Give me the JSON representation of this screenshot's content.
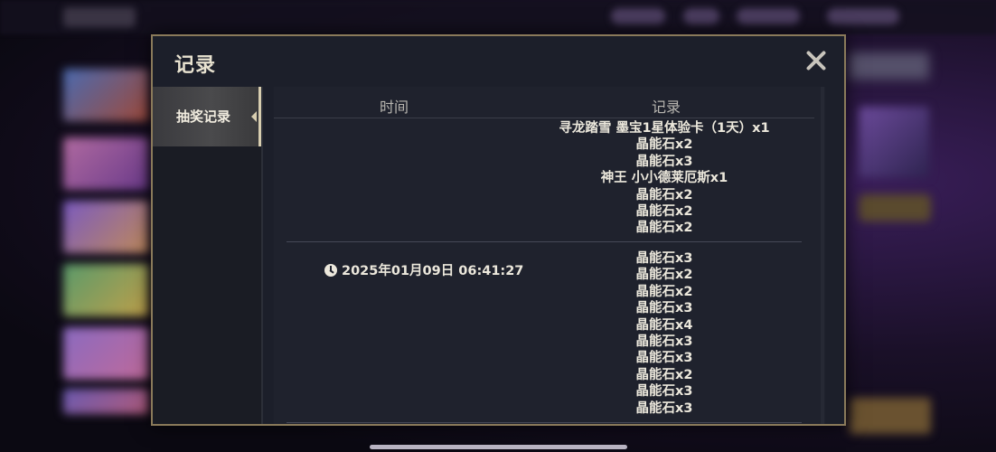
{
  "modal": {
    "title": "记录",
    "close_icon": "close-icon"
  },
  "sidebar": {
    "tabs": [
      {
        "label": "抽奖记录",
        "active": true
      }
    ]
  },
  "table": {
    "headers": {
      "time": "时间",
      "record": "记录"
    },
    "groups": [
      {
        "time": "",
        "items": [
          "寻龙踏雪 墨宝1星体验卡（1天）x1",
          "晶能石x2",
          "晶能石x3",
          "神王 小小德莱厄斯x1",
          "晶能石x2",
          "晶能石x2",
          "晶能石x2"
        ]
      },
      {
        "time": "2025年01月09日 06:41:27",
        "items": [
          "晶能石x3",
          "晶能石x2",
          "晶能石x2",
          "晶能石x3",
          "晶能石x4",
          "晶能石x3",
          "晶能石x3",
          "晶能石x2",
          "晶能石x3",
          "晶能石x3"
        ]
      }
    ]
  },
  "colors": {
    "accent_gold": "#8a7a5a",
    "panel": "#1c1f2a",
    "text": "#ece8dc"
  }
}
